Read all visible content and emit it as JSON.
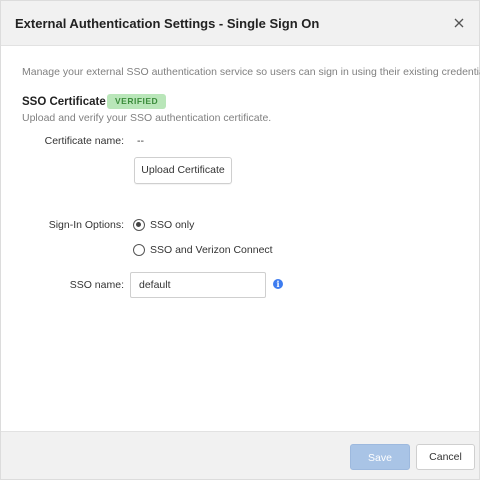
{
  "dialog": {
    "title": "External Authentication Settings - Single Sign On",
    "description": "Manage your external SSO authentication service so users can sign in using their existing credentials."
  },
  "certificate": {
    "section_title": "SSO Certificate",
    "status_badge": "VERIFIED",
    "subtitle": "Upload and verify your SSO authentication certificate.",
    "name_label": "Certificate name:",
    "name_value": "--",
    "upload_button": "Upload Certificate"
  },
  "sign_in": {
    "label": "Sign-In Options:",
    "options": [
      {
        "label": "SSO only",
        "selected": true
      },
      {
        "label": "SSO and Verizon Connect",
        "selected": false
      }
    ]
  },
  "sso_name": {
    "label": "SSO name:",
    "value": "default"
  },
  "footer": {
    "save_label": "Save",
    "cancel_label": "Cancel"
  },
  "colors": {
    "badge_bg": "#b9e6b9",
    "badge_text": "#3c8d3c",
    "save_disabled": "#a9c4e6",
    "info_icon": "#3d7cf0"
  }
}
